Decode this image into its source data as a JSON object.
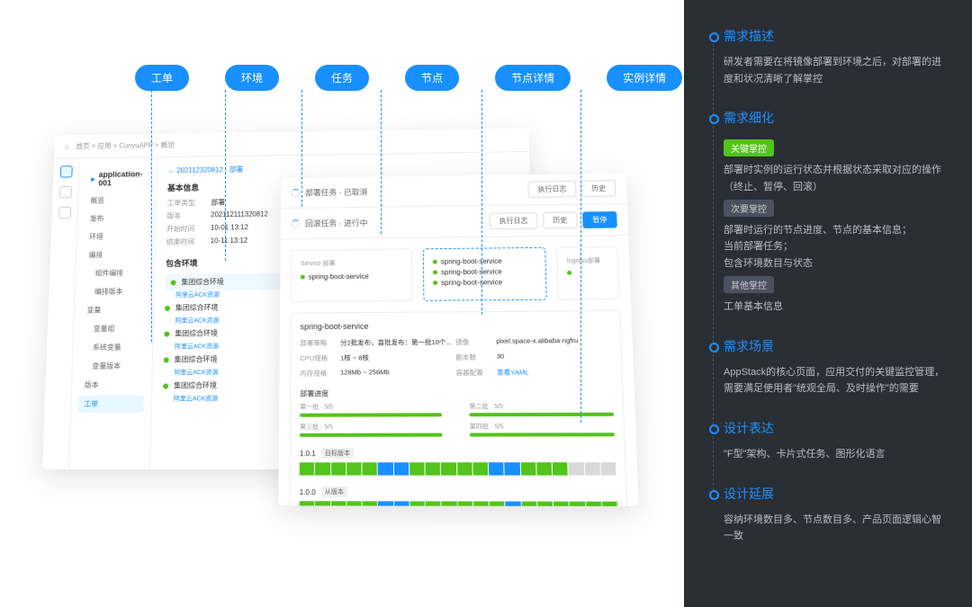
{
  "tags": [
    "工单",
    "环境",
    "任务",
    "节点",
    "节点详情",
    "实例详情"
  ],
  "breadcrumb": "首页 > 应用 > CunyuAPP > 概览",
  "app_name": "application-001",
  "app_sub": "202112320812 - 部署",
  "nav_items": [
    "概览",
    "发布",
    "环境",
    "编排",
    "组件编排",
    "编排版本",
    "变量",
    "变量组",
    "系统变量",
    "变量版本",
    "版本",
    "工单"
  ],
  "nav_active_index": 11,
  "basic_info": {
    "title": "基本信息",
    "rows": [
      {
        "label": "工单类型",
        "value": "部署"
      },
      {
        "label": "版本",
        "value": "202112111320812"
      },
      {
        "label": "开始时间",
        "value": "10-01 13:12"
      },
      {
        "label": "结束时间",
        "value": "10-11 13:12"
      }
    ]
  },
  "env_list": {
    "title": "包含环境",
    "items": [
      "集团综合环境",
      "集团综合环境",
      "集团综合环境",
      "集团综合环境",
      "集团综合环境"
    ],
    "sub": "阿里云ACK资源"
  },
  "task_panel": {
    "cancelled": "部署任务 · 已取消",
    "running": "回滚任务 · 进行中",
    "btn_detail": "执行日志",
    "btn_rollback": "历史",
    "btn_stop": "暂停",
    "service_label": "Service 部署",
    "ingress_label": "Ingress部署",
    "service_name": "spring-boot-service"
  },
  "detail": {
    "name": "spring-boot-service",
    "rows": [
      {
        "label": "部署策略",
        "value": "分2批发布，首批发布：第一批10个..."
      },
      {
        "label": "镜像",
        "value": "pixel.space-x.alibaba-ngfru"
      },
      {
        "label": "CPU规格",
        "value": "1核 ~ 8核"
      },
      {
        "label": "副本数",
        "value": "30"
      },
      {
        "label": "内存规格",
        "value": "128Mb ~ 256Mb"
      },
      {
        "label": "容器配置",
        "value": "查看YAML"
      }
    ],
    "progress_title": "部署进度",
    "batches": [
      {
        "label": "第一批 · 5/5"
      },
      {
        "label": "第二批 · 5/5"
      },
      {
        "label": "第三批 · 5/5"
      },
      {
        "label": "第四批 · 5/5"
      }
    ],
    "versions": [
      {
        "num": "1.0.1",
        "tag": "目标版本"
      },
      {
        "num": "1.0.0",
        "tag": "从版本"
      }
    ]
  },
  "right": {
    "s1_title": "需求描述",
    "s1_text": "研发者需要在将镜像部署到环境之后，对部署的进度和状况清晰了解掌控",
    "s2_title": "需求细化",
    "s2_b1": "关键掌控",
    "s2_t1": "部署时实例的运行状态并根据状态采取对应的操作（终止、暂停、回滚）",
    "s2_b2": "次要掌控",
    "s2_t2a": "部署时运行的节点进度、节点的基本信息；",
    "s2_t2b": "当前部署任务；",
    "s2_t2c": "包含环境数目与状态",
    "s2_b3": "其他掌控",
    "s2_t3": "工单基本信息",
    "s3_title": "需求场景",
    "s3_text": "AppStack的核心页面，应用交付的关键监控管理，需要满足使用者\"统观全局、及时操作\"的需要",
    "s4_title": "设计表达",
    "s4_text": "\"F型\"架构、卡片式任务、图形化语言",
    "s5_title": "设计延展",
    "s5_text": "容纳环境数目多、节点数目多、产品页面逻辑心智一致"
  }
}
